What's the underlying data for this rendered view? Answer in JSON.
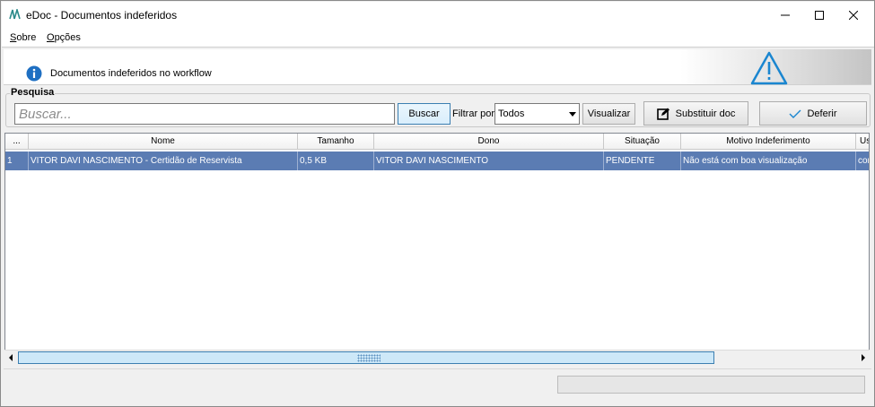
{
  "window": {
    "title": "eDoc - Documentos indeferidos"
  },
  "menu": {
    "sobre": "Sobre",
    "opcoes": "Opções"
  },
  "banner": {
    "message": "Documentos indeferidos no workflow",
    "info_icon": "info-icon",
    "warning_icon": "warning-triangle-icon"
  },
  "search": {
    "group_label": "Pesquisa",
    "placeholder": "Buscar...",
    "value": "",
    "search_button": "Buscar",
    "filter_label": "Filtrar por:",
    "filter_value": "Todos",
    "view_button": "Visualizar",
    "replace_button": "Substituir doc",
    "approve_button": "Deferir"
  },
  "grid": {
    "columns": [
      "...",
      "Nome",
      "Tamanho",
      "Dono",
      "Situação",
      "Motivo Indeferimento",
      "Us"
    ],
    "rows": [
      {
        "index": "1",
        "nome": "VITOR DAVI NASCIMENTO - Certidão de Reservista",
        "tamanho": "0,5 KB",
        "dono": "VITOR DAVI NASCIMENTO",
        "situacao": "PENDENTE",
        "motivo": "Não está com boa visualização",
        "us": "cor"
      }
    ]
  },
  "status": {
    "progress": 0
  },
  "colors": {
    "selected_row": "#5b7cb3",
    "info_blue": "#1e6fc2",
    "warning_blue": "#1a86d0"
  }
}
